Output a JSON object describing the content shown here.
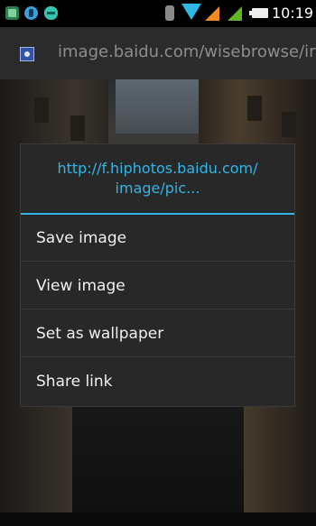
{
  "status_bar": {
    "time": "10:19",
    "left_icons": [
      "app-notification-icon",
      "usb-icon",
      "android-icon"
    ],
    "right_icons": [
      "bluetooth-icon",
      "wifi-icon",
      "signal-sim1-icon",
      "signal-sim2-icon",
      "battery-icon"
    ],
    "colors": {
      "wifi": "#2fb7e6",
      "signal1": "#f08a22",
      "signal2": "#60b623"
    }
  },
  "url_bar": {
    "url": "image.baidu.com/wisebrowse/ir",
    "favicon": "site-favicon-icon"
  },
  "dialog": {
    "title_line1": "http://f.hiphotos.baidu.com/",
    "title_line2": "image/pic...",
    "accent_color": "#33b5e5",
    "items": [
      {
        "label": "Save image"
      },
      {
        "label": "View image"
      },
      {
        "label": "Set as wallpaper"
      },
      {
        "label": "Share link"
      }
    ]
  }
}
